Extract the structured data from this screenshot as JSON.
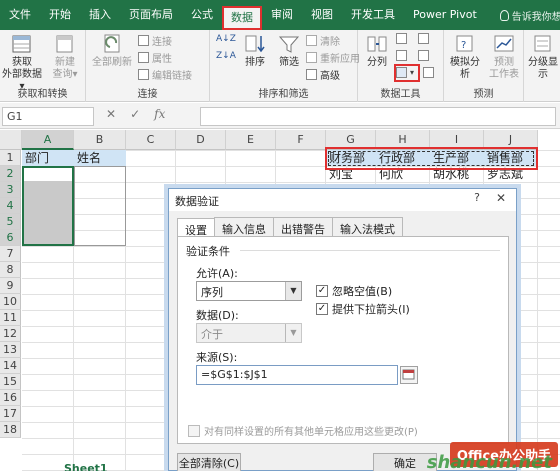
{
  "ribbon_tabs": [
    "文件",
    "开始",
    "插入",
    "页面布局",
    "公式",
    "数据",
    "审阅",
    "视图",
    "开发工具",
    "Power Pivot"
  ],
  "active_tab": "数据",
  "tell_me": "告诉我你想要做什么",
  "groups": {
    "get_transform": {
      "label": "获取和转换",
      "get_external_line1": "获取",
      "get_external_line2": "外部数据▾",
      "new_query_line1": "新建",
      "new_query_line2": "查询▾"
    },
    "connections": {
      "label": "连接",
      "refresh_all": "全部刷新",
      "connections": "连接",
      "properties": "属性",
      "edit_links": "编辑链接"
    },
    "sort_filter": {
      "label": "排序和筛选",
      "sort": "排序",
      "filter": "筛选",
      "clear": "清除",
      "reapply": "重新应用",
      "advanced": "高级"
    },
    "data_tools": {
      "label": "数据工具",
      "text_to_columns": "分列"
    },
    "forecast": {
      "label": "预测",
      "what_if": "模拟分析",
      "forecast_sheet_line1": "预测",
      "forecast_sheet_line2": "工作表"
    },
    "outline": {
      "label": "分级显示"
    }
  },
  "formula_bar": {
    "name_box": "G1",
    "cancel": "✕",
    "enter": "✓",
    "fx": "fx",
    "value": ""
  },
  "columns": [
    "A",
    "B",
    "C",
    "D",
    "E",
    "F",
    "G",
    "H",
    "I",
    "J"
  ],
  "rows": [
    "1",
    "2",
    "3",
    "4",
    "5",
    "6",
    "7",
    "8",
    "9",
    "10",
    "11",
    "12",
    "13",
    "14",
    "15",
    "16",
    "17",
    "18"
  ],
  "cells": {
    "A1": "部门",
    "B1": "姓名",
    "G1": "财务部",
    "H1": "行政部",
    "I1": "生产部",
    "J1": "销售部",
    "G2": "刘宝",
    "H2": "何欣",
    "I2": "胡水桃",
    "J2": "罗志斌"
  },
  "dialog": {
    "title": "数据验证",
    "help": "?",
    "close": "✕",
    "tabs": [
      "设置",
      "输入信息",
      "出错警告",
      "输入法模式"
    ],
    "active_tab": "设置",
    "section": "验证条件",
    "allow_label": "允许(A):",
    "allow_value": "序列",
    "data_label": "数据(D):",
    "data_value": "介于",
    "ignore_blank": "忽略空值(B)",
    "ignore_blank_checked": true,
    "in_cell_dropdown": "提供下拉箭头(I)",
    "in_cell_dropdown_checked": true,
    "source_label": "来源(S):",
    "source_value": "=$G$1:$J$1",
    "apply_all": "对有同样设置的所有其他单元格应用这些更改(P)",
    "apply_all_checked": false,
    "clear_all": "全部清除(C)",
    "ok": "确定"
  },
  "sheet_tab": "Sheet1",
  "watermark": "Office办公助手",
  "watermark2": "shancun.net",
  "colors": {
    "excel_green": "#217346",
    "highlight_red": "#e03030",
    "header_fill": "#d0e4f5",
    "selected_fill": "#c9c9c9"
  }
}
